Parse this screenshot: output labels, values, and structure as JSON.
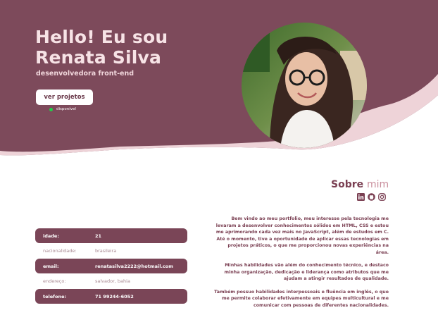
{
  "hero": {
    "greeting": "Hello! Eu sou",
    "name": "Renata Silva",
    "subtitle": "desenvolvedora front-end",
    "cta_label": "ver projetos",
    "status_text": "disponível"
  },
  "about": {
    "title_main": "Sobre",
    "title_accent": "mim",
    "social": [
      "linkedin-icon",
      "github-icon",
      "instagram-icon"
    ],
    "paragraphs": [
      "Bem vindo ao meu portfolio, meu interesse pela tecnologia me levaram a  desenvolver conhecimentos sólidos em HTML, CSS e estou me aprimorando cada vez mais no JavaScript, além de estudos em C. Até o momento, tive a  oportunidade de aplicar essas tecnologias em projetos práticos, o que me proporcionou novas experiências na área.",
      "Minhas habilidades vão além do conhecimento técnico, e destaco minha organização, dedicação e liderança como atributos que me ajudam a atingir resultados de qualidade.",
      "Também possuo habilidades interpessoais e fluência em inglês, o que me permite colaborar efetivamente em equipes multicultural e me comunicar com pessoas de diferentes nacionalidades."
    ]
  },
  "info": [
    {
      "label": "idade:",
      "value": "21",
      "style": "dark"
    },
    {
      "label": "nacionalidade:",
      "value": "brasileira",
      "style": "light"
    },
    {
      "label": "email:",
      "value": "renatasilva2222@hotmail.com",
      "style": "dark"
    },
    {
      "label": "endereço:",
      "value": "salvador, bahia",
      "style": "light"
    },
    {
      "label": "telefone:",
      "value": "71 99244-6052",
      "style": "dark"
    }
  ],
  "colors": {
    "primary": "#7a4557",
    "hero_bg": "#7d4a5b",
    "wave_light": "#f1d9dd",
    "status": "#1fd14a"
  }
}
